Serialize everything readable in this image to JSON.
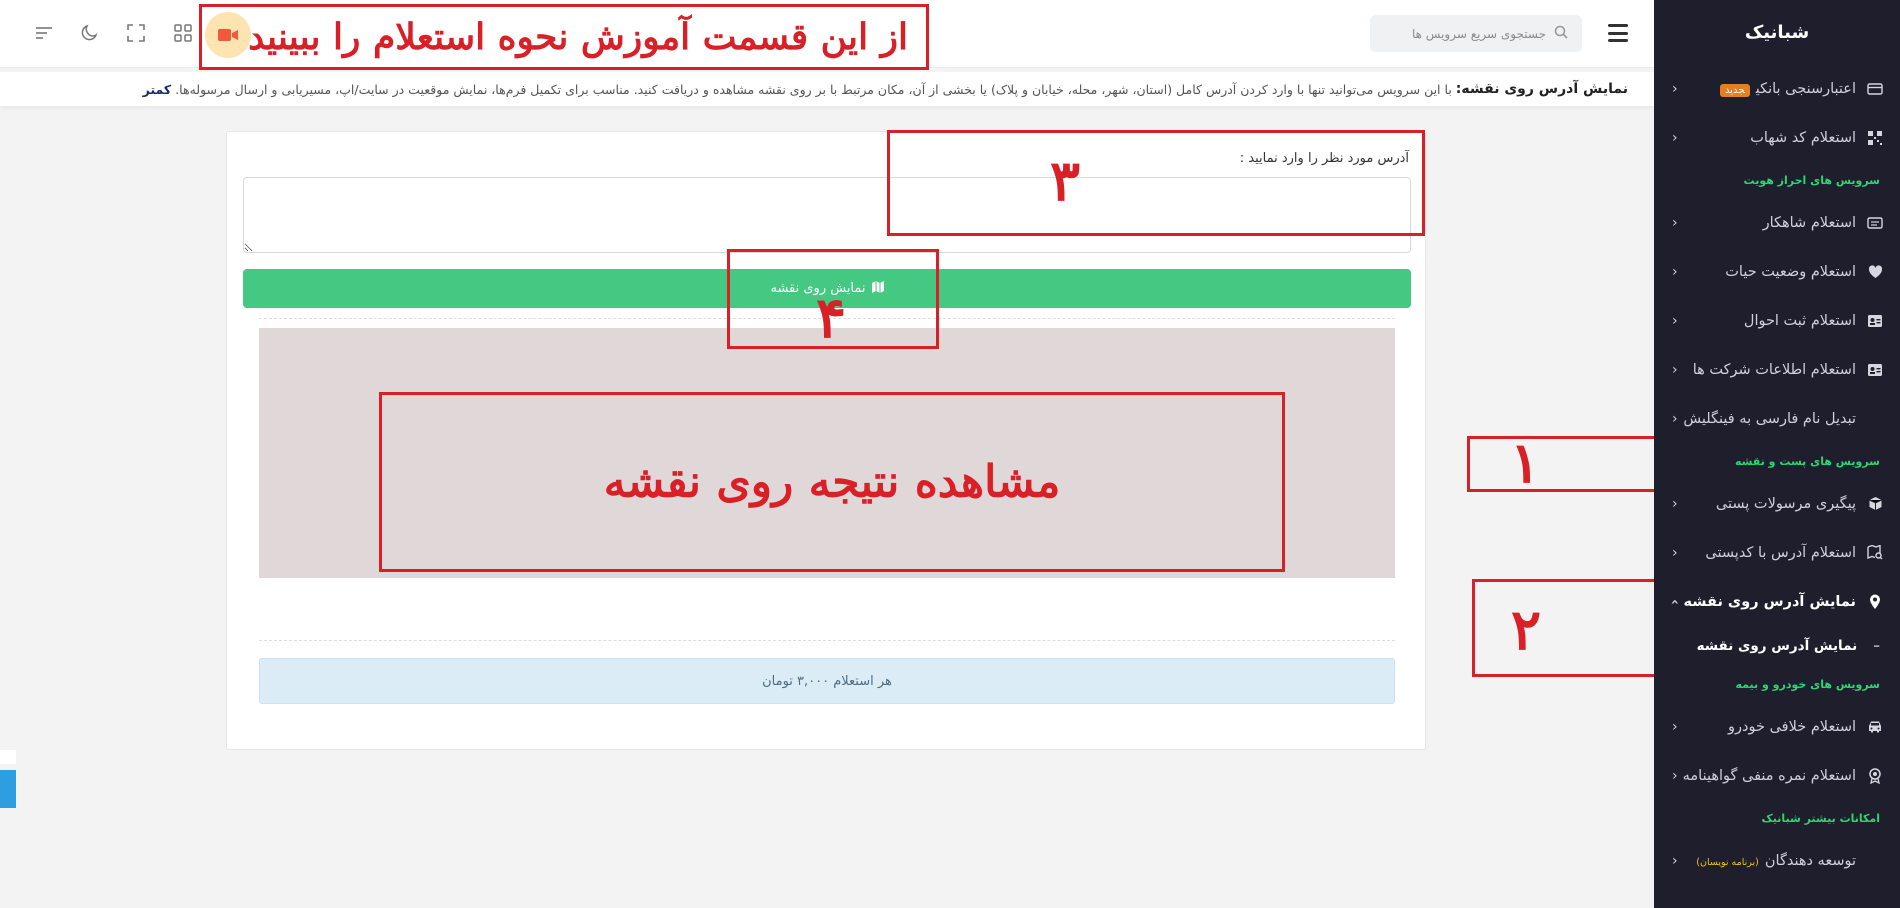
{
  "sidebar": {
    "brand": "شبانیک",
    "items": [
      {
        "type": "item",
        "label": "اعتبارسنجی بانکی",
        "icon": "card-icon",
        "badge": "جدید"
      },
      {
        "type": "item",
        "label": "استعلام کد شهاب",
        "icon": "qr-icon"
      },
      {
        "type": "section",
        "label": "سرویس های احراز هویت"
      },
      {
        "type": "item",
        "label": "استعلام شاهکار",
        "icon": "id-card-icon"
      },
      {
        "type": "item",
        "label": "استعلام وضعیت حیات",
        "icon": "heart-icon"
      },
      {
        "type": "item",
        "label": "استعلام ثبت احوال",
        "icon": "contact-card-icon"
      },
      {
        "type": "item",
        "label": "استعلام اطلاعات شرکت ها",
        "icon": "contact-card-icon"
      },
      {
        "type": "item",
        "label": "تبدیل نام فارسی به فینگلیش",
        "icon": "abc-icon"
      },
      {
        "type": "section",
        "label": "سرویس های پست و نقشه"
      },
      {
        "type": "item",
        "label": "پیگیری مرسولات پستی",
        "icon": "package-icon"
      },
      {
        "type": "item",
        "label": "استعلام آدرس با کدپستی",
        "icon": "map-search-icon"
      },
      {
        "type": "item",
        "label": "نمایش آدرس روی نقشه",
        "icon": "location-pin-icon",
        "active": true
      },
      {
        "type": "subitem",
        "label": "نمایش آدرس روی نقشه"
      },
      {
        "type": "section",
        "label": "سرویس های خودرو و بیمه"
      },
      {
        "type": "item",
        "label": "استعلام خلافی خودرو",
        "icon": "car-icon"
      },
      {
        "type": "item",
        "label": "استعلام نمره منفی گواهینامه",
        "icon": "badge-icon"
      },
      {
        "type": "section",
        "label": "امکانات بیشتر شبانیک"
      },
      {
        "type": "item",
        "label": "توسعه دهندگان",
        "icon": "api-icon",
        "note": "(برنامه نویسان)"
      }
    ]
  },
  "header": {
    "search_placeholder": "جستجوی سریع سرویس ها",
    "tutorial_text": "از این قسمت آموزش نحوه استعلام را ببینید..."
  },
  "description": {
    "title": "نمایش آدرس روی نقشه:",
    "text": "با این سرویس می‌توانید تنها با وارد کردن آدرس کامل (استان، شهر، محله، خیابان و پلاک) یا بخشی از آن، مکان مرتبط با بر روی نقشه مشاهده و دریافت کنید. مناسب برای تکمیل فرم‌ها، نمایش موقعیت در سایت/اپ، مسیریابی و ارسال مرسوله‌ها.",
    "more": "کمتر"
  },
  "form": {
    "address_label": "آدرس مورد نظر را وارد نمایید :",
    "address_value": "",
    "submit_label": "نمایش روی نقشه",
    "price_text": "هر استعلام ۳,۰۰۰ تومان"
  },
  "annotations": {
    "result_text": "مشاهده نتیجه روی نقشه",
    "n1": "۱",
    "n2": "۲",
    "n3": "۳",
    "n4": "۴"
  },
  "colors": {
    "sidebar_bg": "#1e1e2d",
    "section_green": "#2ed573",
    "button_green": "#45c982",
    "annotation_red": "#d92027",
    "price_bg": "#dcecf6"
  }
}
